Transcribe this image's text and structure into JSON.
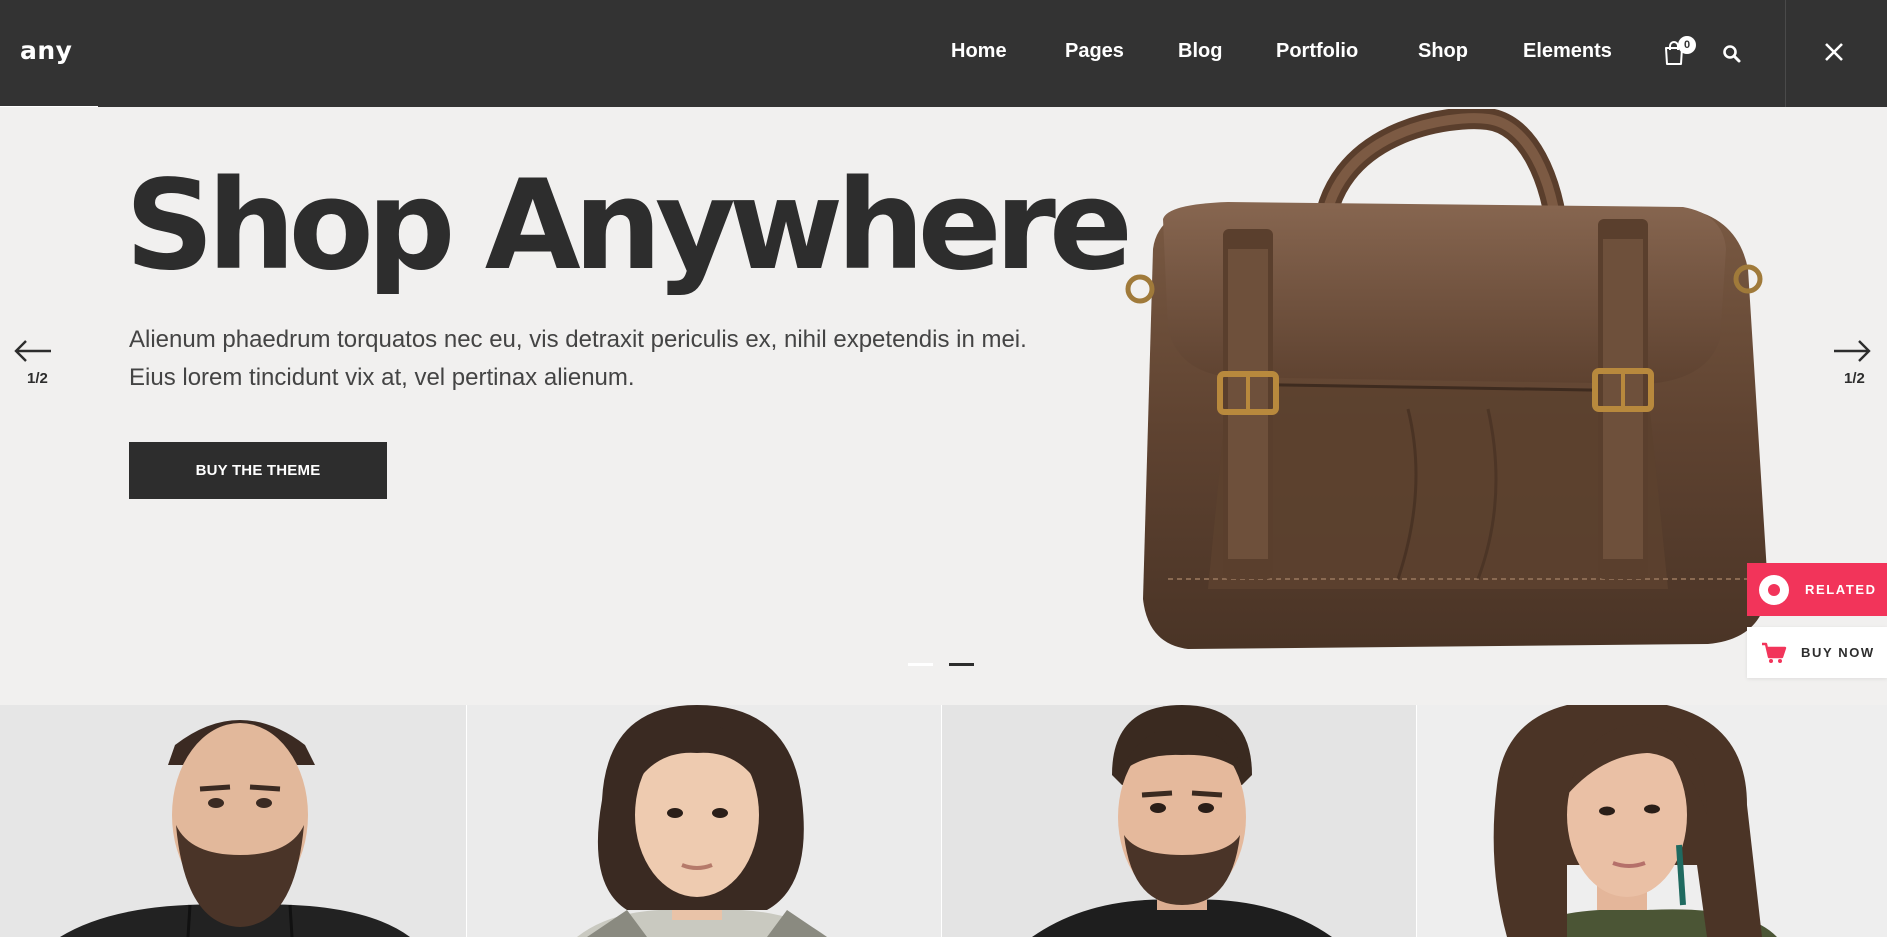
{
  "header": {
    "logo": "any",
    "nav": [
      "Home",
      "Pages",
      "Blog",
      "Portfolio",
      "Shop",
      "Elements"
    ],
    "cart_count": "0",
    "icons": [
      "cart-icon",
      "search-icon",
      "close-icon"
    ]
  },
  "hero": {
    "title": "Shop Anywhere",
    "description_line1": "Alienum phaedrum torquatos nec eu, vis detraxit periculis ex, nihil expetendis in mei.",
    "description_line2": "Eius lorem tincidunt vix at, vel pertinax alienum.",
    "button_label": "BUY THE THEME",
    "prev_counter": "1/2",
    "next_counter": "1/2",
    "slide_count": 2,
    "active_slide": 2
  },
  "side_tabs": {
    "related": "RELATED",
    "buy_now": "BUY NOW"
  },
  "colors": {
    "header_bg": "#333333",
    "hero_bg": "#f1f0ef",
    "accent": "#f2345a",
    "dark": "#2d2d2d"
  }
}
